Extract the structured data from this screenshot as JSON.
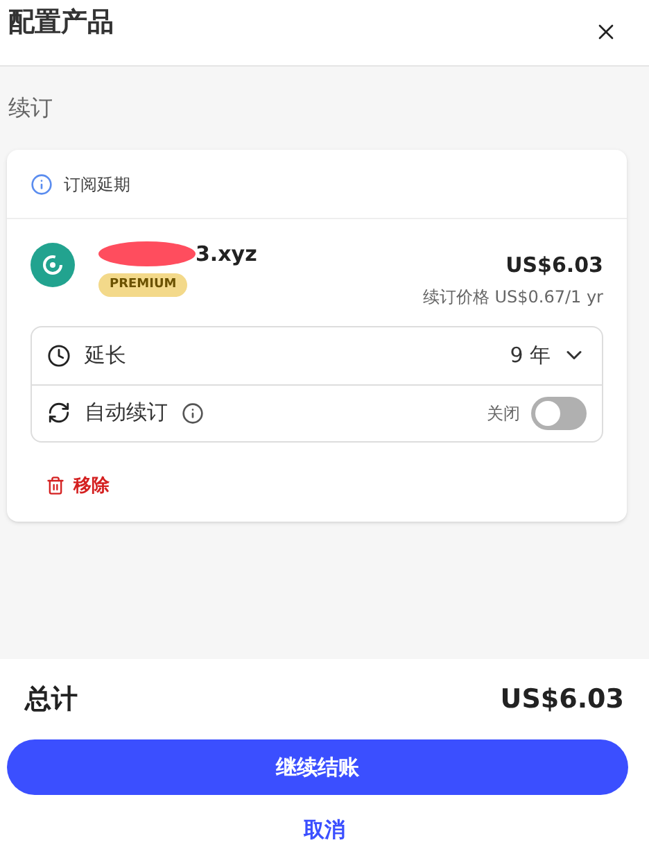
{
  "header": {
    "title": "配置产品"
  },
  "section": {
    "title": "续订"
  },
  "card": {
    "notice": "订阅延期",
    "product": {
      "name": "3.xyz",
      "badge": "PREMIUM",
      "price": "US$6.03",
      "renewal_price": "续订价格 US$0.67/1 yr"
    },
    "options": [
      {
        "kind": "select",
        "label": "延长",
        "value": "9 年"
      },
      {
        "kind": "toggle",
        "label": "自动续订",
        "state_label": "关闭",
        "on": false
      }
    ],
    "remove": "移除"
  },
  "footer": {
    "total_label": "总计",
    "total": "US$6.03",
    "primary": "继续结账",
    "cancel": "取消"
  }
}
